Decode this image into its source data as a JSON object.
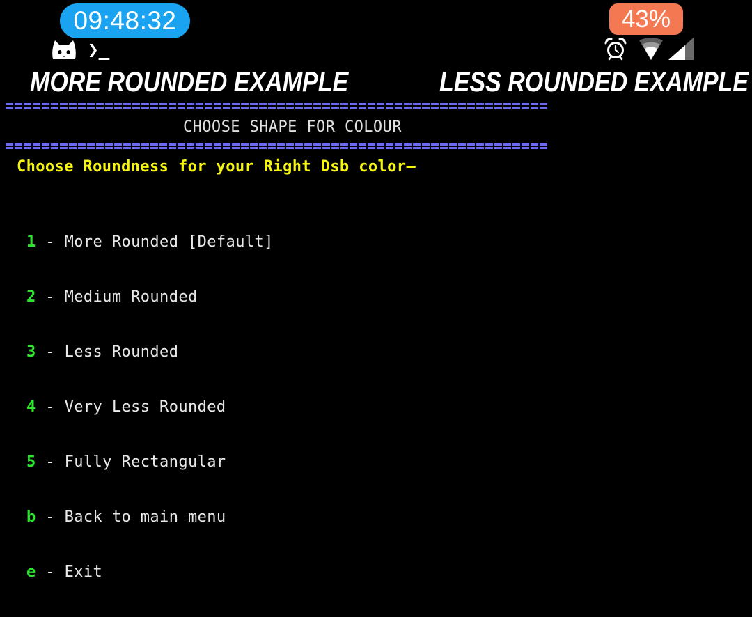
{
  "status_bar": {
    "time": "09:48:32",
    "battery": "43%",
    "icons": [
      "cat-icon",
      "terminal-prompt-icon",
      "alarm-clock-icon",
      "wifi-icon",
      "cellular-signal-icon"
    ],
    "time_pill_color": "#1aa3f0",
    "battery_pill_color": "#f47852"
  },
  "prompt_glyph": "❯_",
  "headings": {
    "left": "MORE ROUNDED EXAMPLE",
    "right": "LESS ROUNDED EXAMPLE"
  },
  "terminal": {
    "banner_title": "CHOOSE SHAPE FOR COLOUR",
    "question": "Choose Roundness for your Right Dsb color—",
    "separator_color": "#6a6bf0",
    "question_color": "#f5f50f",
    "key_color": "#2ee52e",
    "options": [
      {
        "key": "1",
        "label": "More Rounded [Default]"
      },
      {
        "key": "2",
        "label": "Medium Rounded"
      },
      {
        "key": "3",
        "label": "Less Rounded"
      },
      {
        "key": "4",
        "label": "Very Less Rounded"
      },
      {
        "key": "5",
        "label": "Fully Rectangular"
      },
      {
        "key": "b",
        "label": "Back to main menu"
      },
      {
        "key": "e",
        "label": "Exit"
      }
    ]
  }
}
